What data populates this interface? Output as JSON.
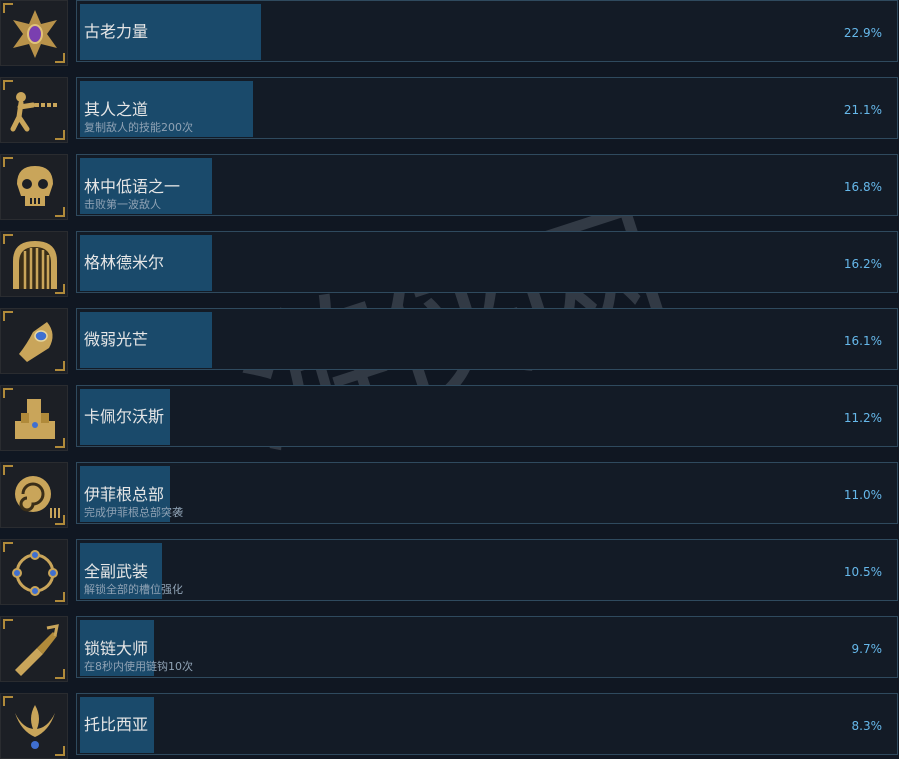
{
  "achievements": [
    {
      "name": "古老力量",
      "desc": "",
      "pct": "22.9%",
      "fill": 0.229,
      "icon": "amulet-gem-icon"
    },
    {
      "name": "其人之道",
      "desc": "复制敌人的技能200次",
      "pct": "21.1%",
      "fill": 0.211,
      "icon": "chain-fighter-icon"
    },
    {
      "name": "林中低语之一",
      "desc": "击败第一波敌人",
      "pct": "16.8%",
      "fill": 0.168,
      "icon": "skull-icon"
    },
    {
      "name": "格林德米尔",
      "desc": "",
      "pct": "16.2%",
      "fill": 0.162,
      "icon": "gate-icon"
    },
    {
      "name": "微弱光芒",
      "desc": "",
      "pct": "16.1%",
      "fill": 0.161,
      "icon": "gem-claw-icon"
    },
    {
      "name": "卡佩尔沃斯",
      "desc": "",
      "pct": "11.2%",
      "fill": 0.112,
      "icon": "castle-icon"
    },
    {
      "name": "伊菲根总部",
      "desc": "完成伊菲根总部突袭",
      "pct": "11.0%",
      "fill": 0.11,
      "icon": "spiral-icon"
    },
    {
      "name": "全副武装",
      "desc": "解锁全部的槽位强化",
      "pct": "10.5%",
      "fill": 0.105,
      "icon": "ring-of-gems-icon"
    },
    {
      "name": "锁链大师",
      "desc": "在8秒内使用链钩10次",
      "pct": "9.7%",
      "fill": 0.097,
      "icon": "chain-hook-icon"
    },
    {
      "name": "托比西亚",
      "desc": "",
      "pct": "8.3%",
      "fill": 0.083,
      "icon": "crest-icon"
    }
  ],
  "watermark": "游侠网",
  "colors": {
    "bar": "#1a4a6b",
    "percent": "#66b8ea",
    "gold": "#c9a55a"
  }
}
